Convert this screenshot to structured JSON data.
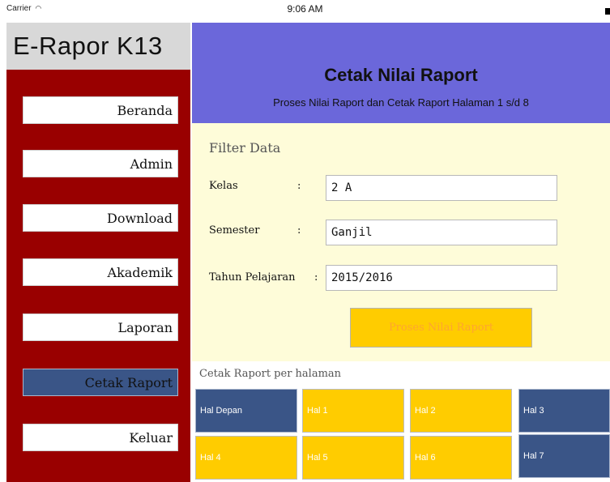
{
  "status_bar": {
    "carrier": "Carrier",
    "wifi_icon": "◠",
    "time": "9:06 AM"
  },
  "app": {
    "title": "E-Rapor K13"
  },
  "sidebar": {
    "items": [
      {
        "label": "Beranda"
      },
      {
        "label": "Admin"
      },
      {
        "label": "Download"
      },
      {
        "label": "Akademik"
      },
      {
        "label": "Laporan"
      },
      {
        "label": "Cetak Raport",
        "active": true
      },
      {
        "label": "Keluar"
      }
    ]
  },
  "header": {
    "title": "Cetak Nilai Raport",
    "subtitle": "Proses Nilai Raport dan Cetak Raport Halaman 1 s/d 8"
  },
  "filter": {
    "title": "Filter Data",
    "fields": [
      {
        "label": "Kelas",
        "colon": ":",
        "value": "2 A"
      },
      {
        "label": "Semester",
        "colon": ":",
        "value": "Ganjil"
      },
      {
        "label": "Tahun Pelajaran",
        "colon": ":",
        "value": "2015/2016"
      }
    ],
    "process_button": "Proses Nilai Raport"
  },
  "print": {
    "label": "Cetak Raport per halaman",
    "pages": [
      {
        "label": "Hal Depan"
      },
      {
        "label": "Hal 1"
      },
      {
        "label": "Hal 2"
      },
      {
        "label": "Hal 3"
      },
      {
        "label": "Hal 4"
      },
      {
        "label": "Hal 5"
      },
      {
        "label": "Hal 6"
      },
      {
        "label": "Hal 7"
      }
    ]
  },
  "colors": {
    "sidebar_bg": "#990000",
    "header_bg": "#6b67da",
    "filter_bg": "#fefcd9",
    "accent_yellow": "#ffcc00",
    "accent_blue": "#3a5587"
  }
}
